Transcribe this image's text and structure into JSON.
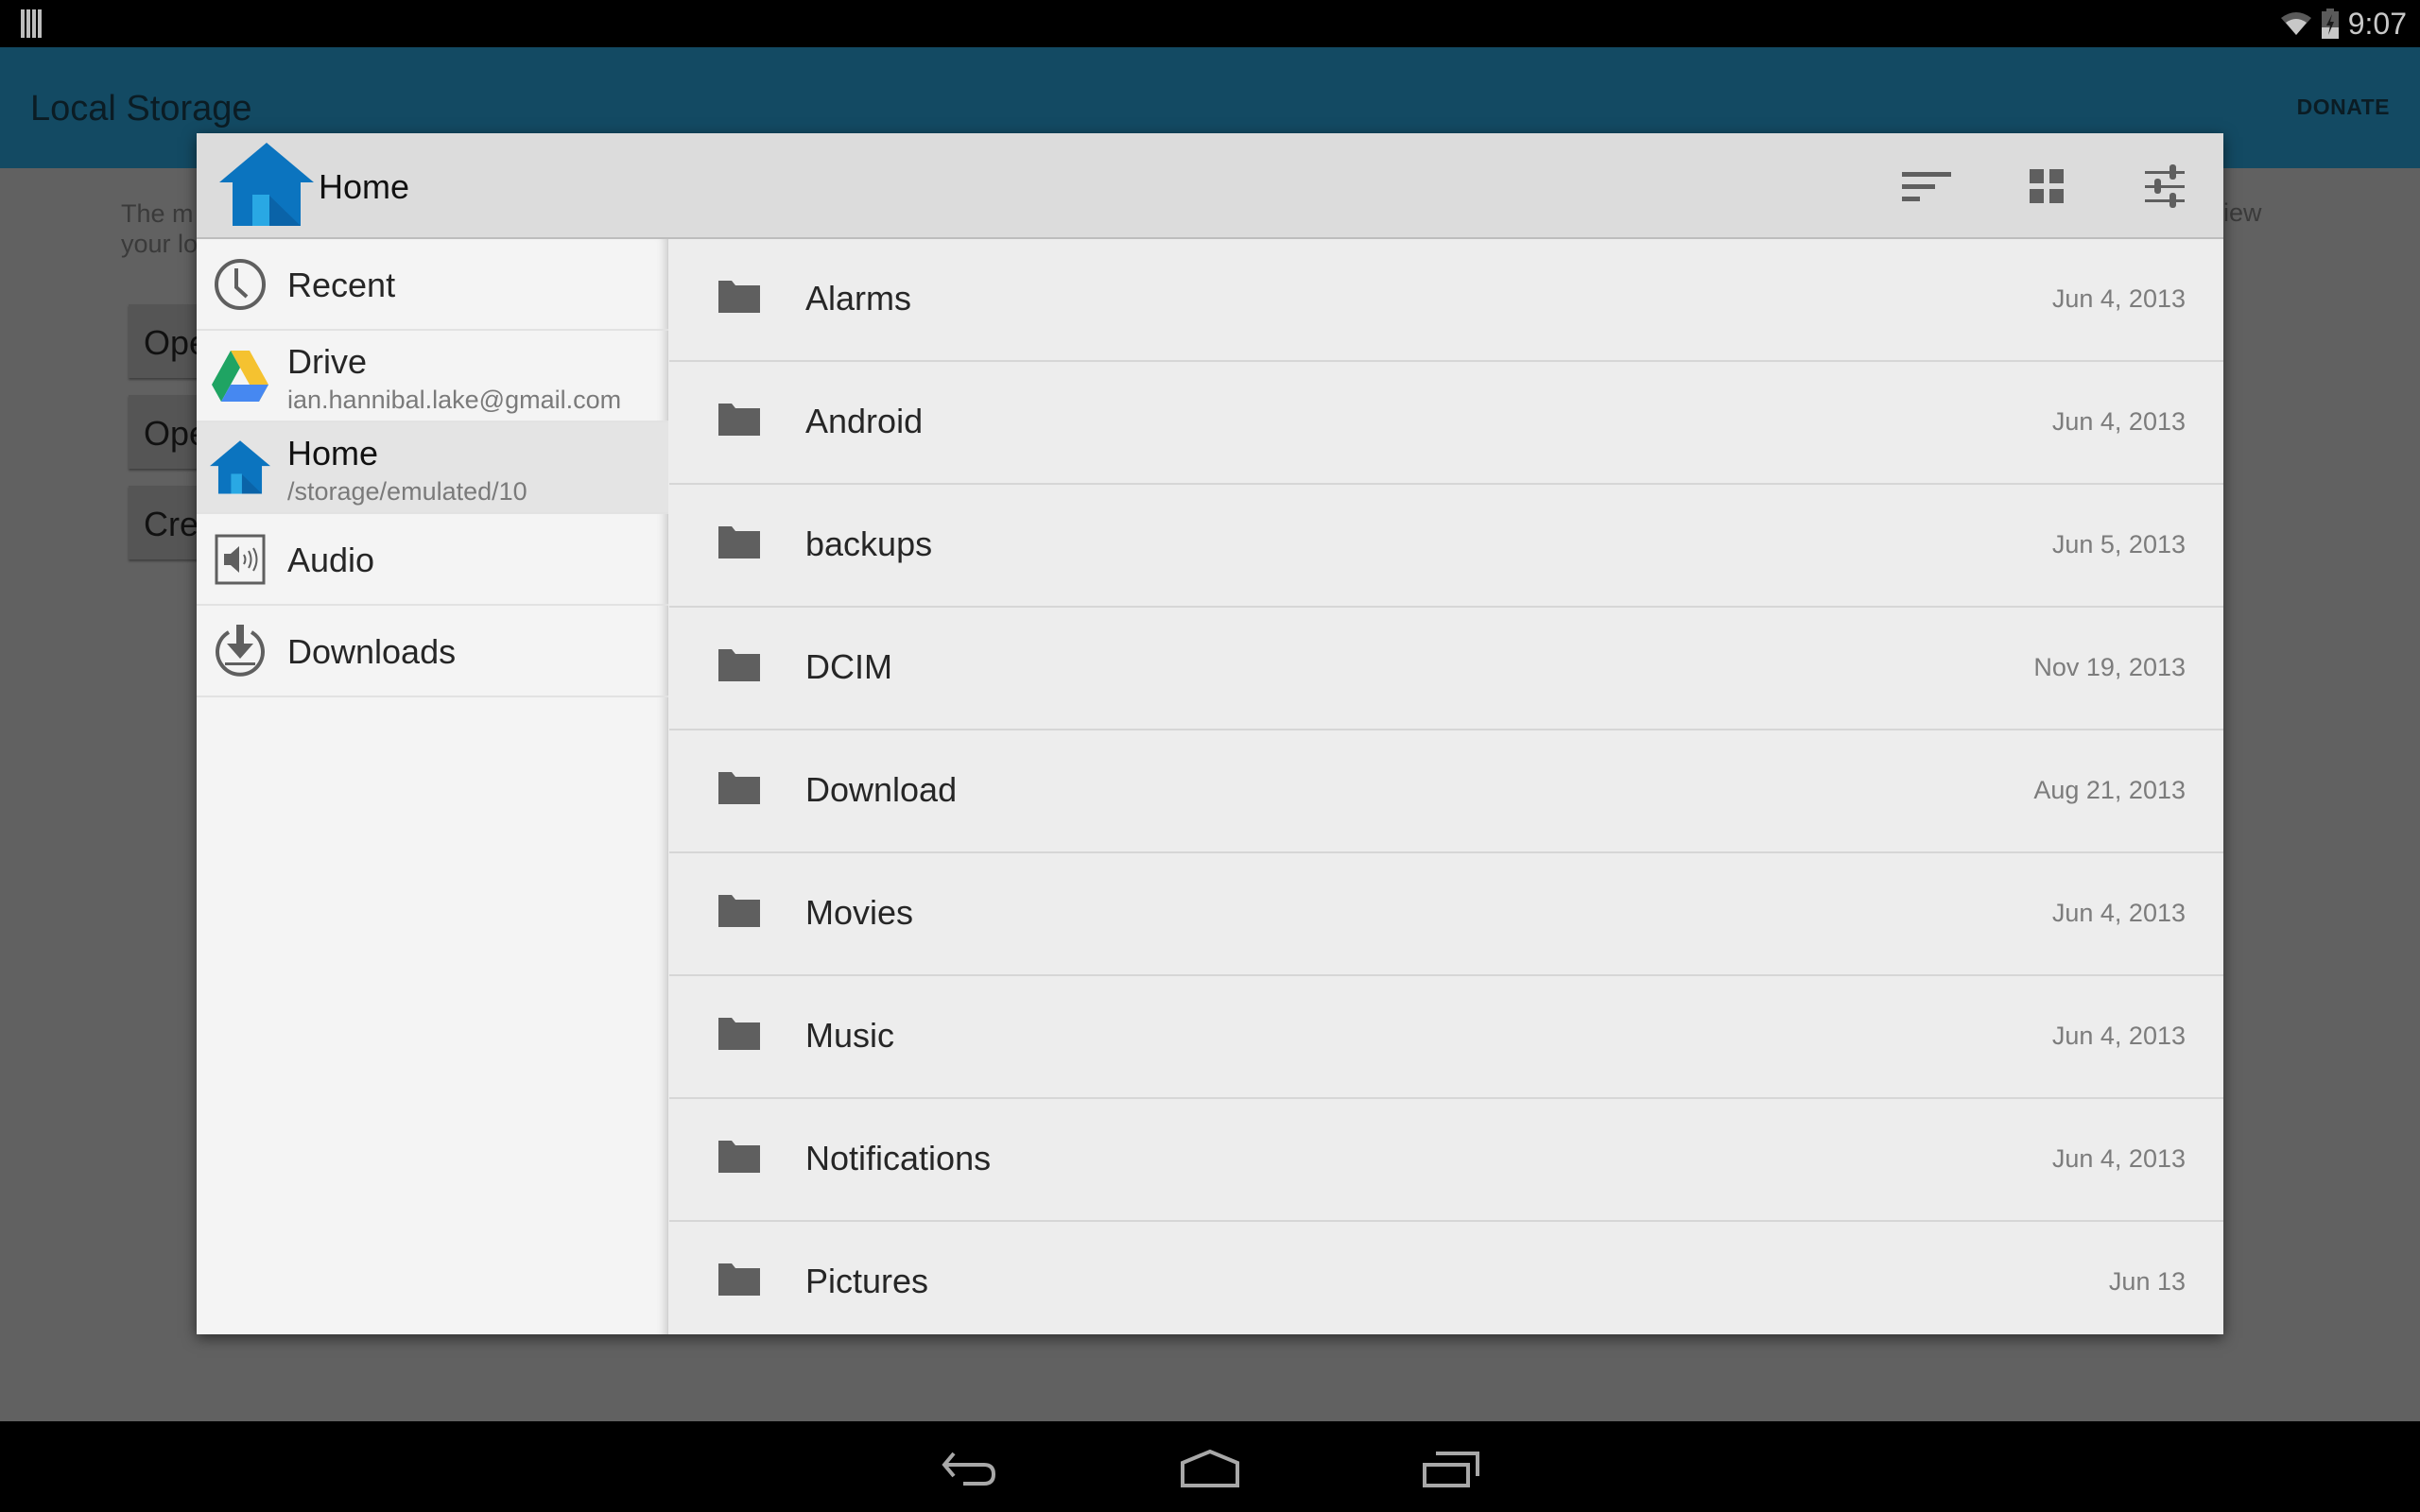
{
  "status_bar": {
    "time": "9:07",
    "icons": [
      "notification-icon",
      "wifi-icon",
      "battery-charging-icon"
    ]
  },
  "app_bar": {
    "title": "Local Storage",
    "donate_label": "DONATE"
  },
  "background": {
    "description_line1": "The m",
    "description_line2": "your lo",
    "description_right": "iew",
    "buttons": [
      "Ope",
      "Ope",
      "Cre"
    ]
  },
  "dialog": {
    "title": "Home",
    "title_icon": "home-icon",
    "toolbar": {
      "sort_icon": "sort-icon",
      "grid_icon": "grid-view-icon",
      "settings_icon": "settings-sliders-icon"
    },
    "sidebar": {
      "items": [
        {
          "label": "Recent",
          "subtitle": null,
          "icon": "clock-icon",
          "selected": false
        },
        {
          "label": "Drive",
          "subtitle": "ian.hannibal.lake@gmail.com",
          "icon": "drive-icon",
          "selected": false
        },
        {
          "label": "Home",
          "subtitle": "/storage/emulated/10",
          "icon": "home-icon",
          "selected": true
        },
        {
          "label": "Audio",
          "subtitle": null,
          "icon": "audio-icon",
          "selected": false
        },
        {
          "label": "Downloads",
          "subtitle": null,
          "icon": "download-icon",
          "selected": false
        }
      ]
    },
    "files": [
      {
        "name": "Alarms",
        "date": "Jun 4, 2013",
        "type": "folder"
      },
      {
        "name": "Android",
        "date": "Jun 4, 2013",
        "type": "folder"
      },
      {
        "name": "backups",
        "date": "Jun 5, 2013",
        "type": "folder"
      },
      {
        "name": "DCIM",
        "date": "Nov 19, 2013",
        "type": "folder"
      },
      {
        "name": "Download",
        "date": "Aug 21, 2013",
        "type": "folder"
      },
      {
        "name": "Movies",
        "date": "Jun 4, 2013",
        "type": "folder"
      },
      {
        "name": "Music",
        "date": "Jun 4, 2013",
        "type": "folder"
      },
      {
        "name": "Notifications",
        "date": "Jun 4, 2013",
        "type": "folder"
      },
      {
        "name": "Pictures",
        "date": "Jun 13",
        "type": "folder"
      }
    ]
  },
  "nav_bar": {
    "buttons": [
      "back-icon",
      "home-icon",
      "recents-icon"
    ]
  },
  "colors": {
    "app_bar": "#134a63",
    "home_icon_blue": "#0b74bf",
    "home_icon_door": "#29a8e4",
    "scrim": "#616161",
    "icon_gray": "#5f5f5f"
  }
}
